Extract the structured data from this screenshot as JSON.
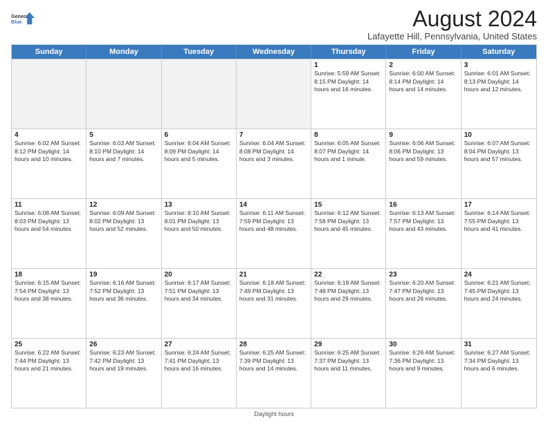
{
  "logo": {
    "line1": "General",
    "line2": "Blue"
  },
  "title": "August 2024",
  "location": "Lafayette Hill, Pennsylvania, United States",
  "days_of_week": [
    "Sunday",
    "Monday",
    "Tuesday",
    "Wednesday",
    "Thursday",
    "Friday",
    "Saturday"
  ],
  "footer": "Daylight hours",
  "weeks": [
    [
      {
        "day": "",
        "info": "",
        "shaded": true
      },
      {
        "day": "",
        "info": "",
        "shaded": true
      },
      {
        "day": "",
        "info": "",
        "shaded": true
      },
      {
        "day": "",
        "info": "",
        "shaded": true
      },
      {
        "day": "1",
        "info": "Sunrise: 5:59 AM\nSunset: 8:15 PM\nDaylight: 14 hours\nand 16 minutes.",
        "shaded": false
      },
      {
        "day": "2",
        "info": "Sunrise: 6:00 AM\nSunset: 8:14 PM\nDaylight: 14 hours\nand 14 minutes.",
        "shaded": false
      },
      {
        "day": "3",
        "info": "Sunrise: 6:01 AM\nSunset: 8:13 PM\nDaylight: 14 hours\nand 12 minutes.",
        "shaded": false
      }
    ],
    [
      {
        "day": "4",
        "info": "Sunrise: 6:02 AM\nSunset: 8:12 PM\nDaylight: 14 hours\nand 10 minutes.",
        "shaded": false
      },
      {
        "day": "5",
        "info": "Sunrise: 6:03 AM\nSunset: 8:10 PM\nDaylight: 14 hours\nand 7 minutes.",
        "shaded": false
      },
      {
        "day": "6",
        "info": "Sunrise: 6:04 AM\nSunset: 8:09 PM\nDaylight: 14 hours\nand 5 minutes.",
        "shaded": false
      },
      {
        "day": "7",
        "info": "Sunrise: 6:04 AM\nSunset: 8:08 PM\nDaylight: 14 hours\nand 3 minutes.",
        "shaded": false
      },
      {
        "day": "8",
        "info": "Sunrise: 6:05 AM\nSunset: 8:07 PM\nDaylight: 14 hours\nand 1 minute.",
        "shaded": false
      },
      {
        "day": "9",
        "info": "Sunrise: 6:06 AM\nSunset: 8:06 PM\nDaylight: 13 hours\nand 59 minutes.",
        "shaded": false
      },
      {
        "day": "10",
        "info": "Sunrise: 6:07 AM\nSunset: 8:04 PM\nDaylight: 13 hours\nand 57 minutes.",
        "shaded": false
      }
    ],
    [
      {
        "day": "11",
        "info": "Sunrise: 6:08 AM\nSunset: 8:03 PM\nDaylight: 13 hours\nand 54 minutes.",
        "shaded": false
      },
      {
        "day": "12",
        "info": "Sunrise: 6:09 AM\nSunset: 8:02 PM\nDaylight: 13 hours\nand 52 minutes.",
        "shaded": false
      },
      {
        "day": "13",
        "info": "Sunrise: 6:10 AM\nSunset: 8:01 PM\nDaylight: 13 hours\nand 50 minutes.",
        "shaded": false
      },
      {
        "day": "14",
        "info": "Sunrise: 6:11 AM\nSunset: 7:59 PM\nDaylight: 13 hours\nand 48 minutes.",
        "shaded": false
      },
      {
        "day": "15",
        "info": "Sunrise: 6:12 AM\nSunset: 7:58 PM\nDaylight: 13 hours\nand 45 minutes.",
        "shaded": false
      },
      {
        "day": "16",
        "info": "Sunrise: 6:13 AM\nSunset: 7:57 PM\nDaylight: 13 hours\nand 43 minutes.",
        "shaded": false
      },
      {
        "day": "17",
        "info": "Sunrise: 6:14 AM\nSunset: 7:55 PM\nDaylight: 13 hours\nand 41 minutes.",
        "shaded": false
      }
    ],
    [
      {
        "day": "18",
        "info": "Sunrise: 6:15 AM\nSunset: 7:54 PM\nDaylight: 13 hours\nand 38 minutes.",
        "shaded": false
      },
      {
        "day": "19",
        "info": "Sunrise: 6:16 AM\nSunset: 7:52 PM\nDaylight: 13 hours\nand 36 minutes.",
        "shaded": false
      },
      {
        "day": "20",
        "info": "Sunrise: 6:17 AM\nSunset: 7:51 PM\nDaylight: 13 hours\nand 34 minutes.",
        "shaded": false
      },
      {
        "day": "21",
        "info": "Sunrise: 6:18 AM\nSunset: 7:49 PM\nDaylight: 13 hours\nand 31 minutes.",
        "shaded": false
      },
      {
        "day": "22",
        "info": "Sunrise: 6:19 AM\nSunset: 7:48 PM\nDaylight: 13 hours\nand 29 minutes.",
        "shaded": false
      },
      {
        "day": "23",
        "info": "Sunrise: 6:20 AM\nSunset: 7:47 PM\nDaylight: 13 hours\nand 26 minutes.",
        "shaded": false
      },
      {
        "day": "24",
        "info": "Sunrise: 6:21 AM\nSunset: 7:45 PM\nDaylight: 13 hours\nand 24 minutes.",
        "shaded": false
      }
    ],
    [
      {
        "day": "25",
        "info": "Sunrise: 6:22 AM\nSunset: 7:44 PM\nDaylight: 13 hours\nand 21 minutes.",
        "shaded": false
      },
      {
        "day": "26",
        "info": "Sunrise: 6:23 AM\nSunset: 7:42 PM\nDaylight: 13 hours\nand 19 minutes.",
        "shaded": false
      },
      {
        "day": "27",
        "info": "Sunrise: 6:24 AM\nSunset: 7:41 PM\nDaylight: 13 hours\nand 16 minutes.",
        "shaded": false
      },
      {
        "day": "28",
        "info": "Sunrise: 6:25 AM\nSunset: 7:39 PM\nDaylight: 13 hours\nand 14 minutes.",
        "shaded": false
      },
      {
        "day": "29",
        "info": "Sunrise: 6:25 AM\nSunset: 7:37 PM\nDaylight: 13 hours\nand 11 minutes.",
        "shaded": false
      },
      {
        "day": "30",
        "info": "Sunrise: 6:26 AM\nSunset: 7:36 PM\nDaylight: 13 hours\nand 9 minutes.",
        "shaded": false
      },
      {
        "day": "31",
        "info": "Sunrise: 6:27 AM\nSunset: 7:34 PM\nDaylight: 13 hours\nand 6 minutes.",
        "shaded": false
      }
    ]
  ]
}
